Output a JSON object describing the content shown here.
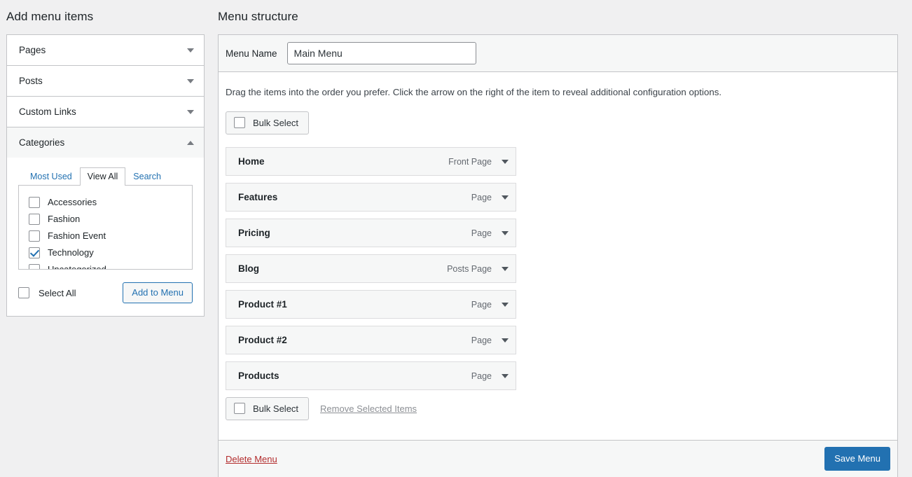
{
  "headings": {
    "left": "Add menu items",
    "right": "Menu structure"
  },
  "add_menu_items": {
    "panels": [
      {
        "label": "Pages",
        "expanded": false,
        "arrow_icon": "chevron-down-icon"
      },
      {
        "label": "Posts",
        "expanded": false,
        "arrow_icon": "chevron-down-icon"
      },
      {
        "label": "Custom Links",
        "expanded": false,
        "arrow_icon": "chevron-down-icon"
      },
      {
        "label": "Categories",
        "expanded": true,
        "arrow_icon": "chevron-up-icon"
      }
    ],
    "categories": {
      "tabs": [
        {
          "label": "Most Used",
          "active": false
        },
        {
          "label": "View All",
          "active": true
        },
        {
          "label": "Search",
          "active": false
        }
      ],
      "items": [
        {
          "label": "Accessories",
          "checked": false
        },
        {
          "label": "Fashion",
          "checked": false
        },
        {
          "label": "Fashion Event",
          "checked": false
        },
        {
          "label": "Technology",
          "checked": true
        },
        {
          "label": "Uncategorized",
          "checked": false
        }
      ],
      "select_all_label": "Select All",
      "select_all_checked": false,
      "add_button_label": "Add to Menu"
    }
  },
  "menu_structure": {
    "menu_name_label": "Menu Name",
    "menu_name_value": "Main Menu",
    "menu_name_placeholder": "Menu Name",
    "instructions": "Drag the items into the order you prefer. Click the arrow on the right of the item to reveal additional configuration options.",
    "bulk_select_top": {
      "label": "Bulk Select",
      "checked": false
    },
    "bulk_select_bottom": {
      "label": "Bulk Select",
      "checked": false
    },
    "remove_selected_label": "Remove Selected Items",
    "items": [
      {
        "title": "Home",
        "type": "Front Page"
      },
      {
        "title": "Features",
        "type": "Page"
      },
      {
        "title": "Pricing",
        "type": "Page"
      },
      {
        "title": "Blog",
        "type": "Posts Page"
      },
      {
        "title": "Product #1",
        "type": "Page"
      },
      {
        "title": "Product #2",
        "type": "Page"
      },
      {
        "title": "Products",
        "type": "Page"
      }
    ]
  },
  "footer": {
    "delete_label": "Delete Menu",
    "save_label": "Save Menu"
  },
  "colors": {
    "accent_blue": "#2271b1",
    "danger_red": "#b32d2e",
    "page_background": "#f0f0f1",
    "panel_background": "#ffffff",
    "row_background": "#f6f7f7",
    "border": "#c3c4c7"
  }
}
